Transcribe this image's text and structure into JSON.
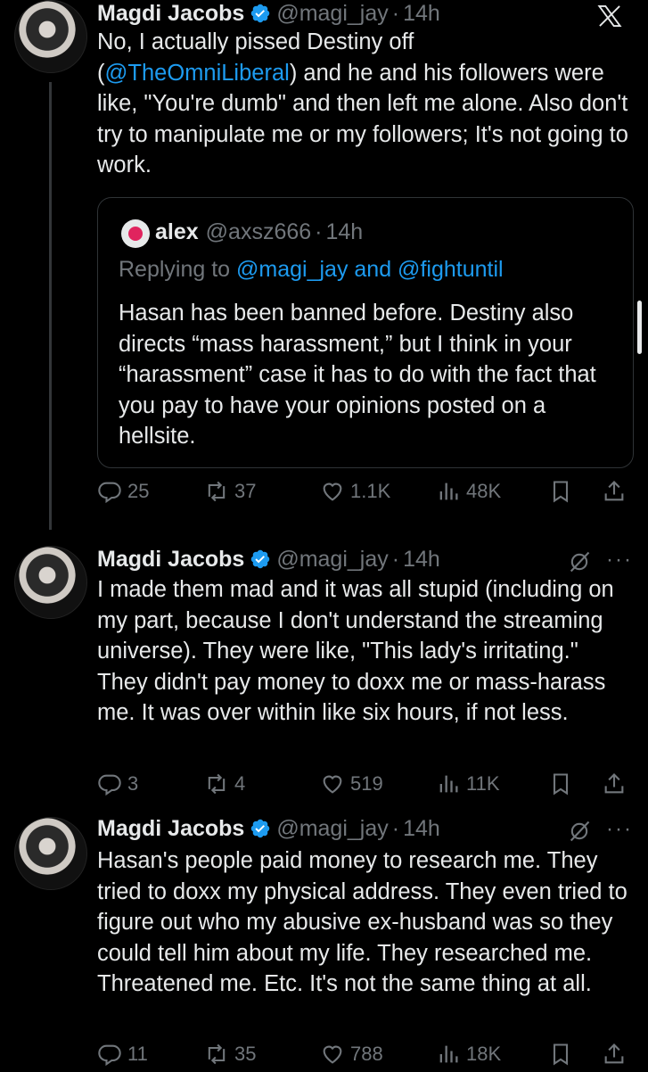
{
  "tweets": [
    {
      "name": "Magdi Jacobs",
      "handle": "@magi_jay",
      "dot": "·",
      "time": "14h",
      "text_pre": "No, I actually pissed Destiny off\n(",
      "mention": "@TheOmniLiberal",
      "text_post": ") and he and his followers were like, \"You're dumb\" and then left me alone. Also don't try to manipulate me or my followers; It's not going to work.",
      "quote": {
        "name": "alex",
        "handle": "@axsz666",
        "dot": "·",
        "time": "14h",
        "replying_label": "Replying to ",
        "replying_to": "@magi_jay and @fightuntil",
        "text": "Hasan has been banned before. Destiny also directs “mass harassment,” but I think in your “harassment” case it has to do with the fact that you pay to have your opinions posted on a hellsite."
      },
      "stats": {
        "replies": "25",
        "reposts": "37",
        "likes": "1.1K",
        "views": "48K"
      }
    },
    {
      "name": "Magdi Jacobs",
      "handle": "@magi_jay",
      "dot": "·",
      "time": "14h",
      "more": "···",
      "text": "I made them mad and it was all stupid (including on my part, because I don't understand the streaming universe). They were like, \"This lady's irritating.\" They didn't pay money to doxx me or mass-harass me. It was over within like six hours, if not less.",
      "stats": {
        "replies": "3",
        "reposts": "4",
        "likes": "519",
        "views": "11K"
      }
    },
    {
      "name": "Magdi Jacobs",
      "handle": "@magi_jay",
      "dot": "·",
      "time": "14h",
      "more": "···",
      "text": "Hasan's people paid money to research me. They tried to doxx my physical address. They even tried to figure out who my abusive ex-husband was so they could tell him about my life. They researched me. Threatened me. Etc. It's not the same thing at all.",
      "stats": {
        "replies": "11",
        "reposts": "35",
        "likes": "788",
        "views": "18K"
      }
    }
  ],
  "icons": {
    "verified": "verified-badge-icon",
    "x_logo": "x-logo-icon",
    "reply": "reply-icon",
    "repost": "repost-icon",
    "like": "like-icon",
    "views": "views-icon",
    "bookmark": "bookmark-icon",
    "share": "share-icon",
    "grok": "grok-icon"
  },
  "colors": {
    "background": "#000000",
    "text": "#e7e9ea",
    "secondary": "#71767b",
    "accent": "#1d9bf0"
  }
}
